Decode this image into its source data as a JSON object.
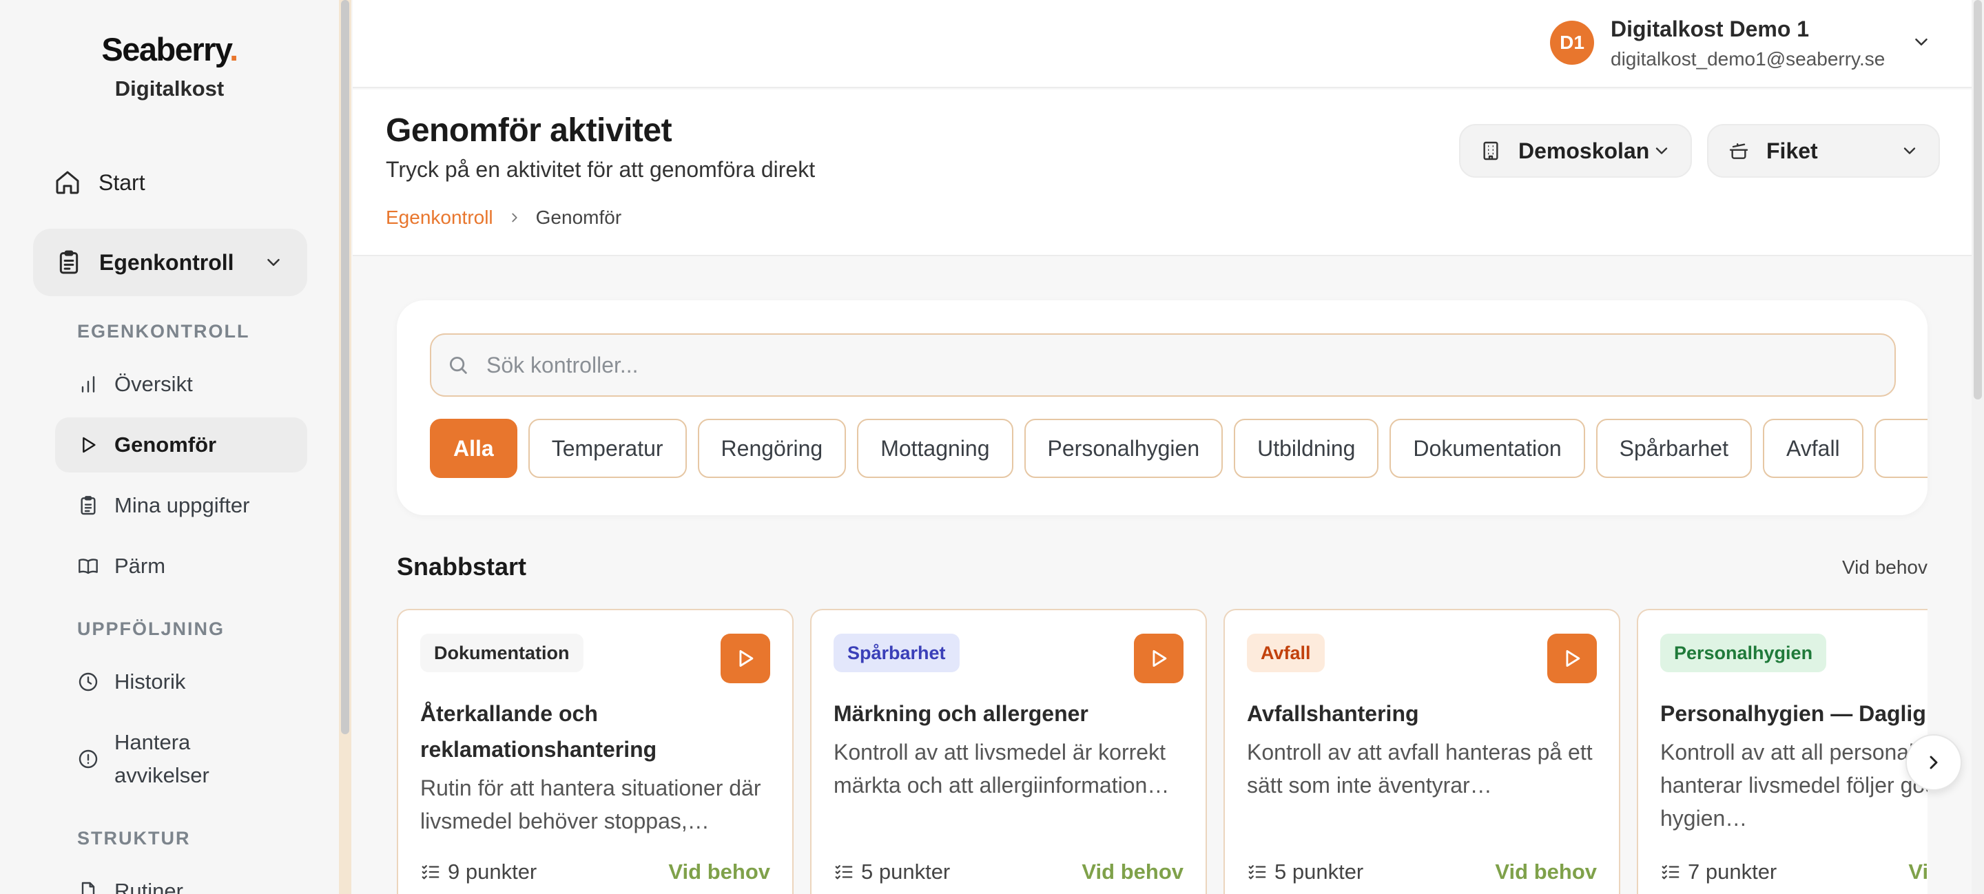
{
  "brand": {
    "name": "Seaberry",
    "dot": ".",
    "subtitle": "Digitalkost"
  },
  "sidebar": {
    "start_label": "Start",
    "group_label": "Egenkontroll",
    "sections": {
      "egenkontroll": "EGENKONTROLL",
      "uppfoljning": "UPPFÖLJNING",
      "struktur": "STRUKTUR"
    },
    "items": {
      "oversikt": "Översikt",
      "genomfor": "Genomför",
      "mina_uppgifter": "Mina uppgifter",
      "parm": "Pärm",
      "historik": "Historik",
      "hantera_avvikelser": "Hantera avvikelser",
      "rutiner": "Rutiner"
    }
  },
  "user": {
    "initials": "D1",
    "name": "Digitalkost Demo 1",
    "email": "digitalkost_demo1@seaberry.se"
  },
  "header": {
    "title": "Genomför aktivitet",
    "subtitle": "Tryck på en aktivitet för att genomföra direkt",
    "breadcrumb": {
      "parent": "Egenkontroll",
      "current": "Genomför"
    },
    "school_select": "Demoskolan",
    "kitchen_select": "Fiket"
  },
  "search": {
    "placeholder": "Sök kontroller...",
    "value": ""
  },
  "filters": [
    "Alla",
    "Temperatur",
    "Rengöring",
    "Mottagning",
    "Personalhygien",
    "Utbildning",
    "Dokumentation",
    "Spårbarhet",
    "Avfall",
    ""
  ],
  "quickstart": {
    "title": "Snabbstart",
    "right_label": "Vid behov",
    "cards": [
      {
        "category": "Dokumentation",
        "title": "Återkallande och reklamationshantering",
        "description": "Rutin för att hantera situationer där livsmedel behöver stoppas,…",
        "points": "9 punkter",
        "frequency": "Vid behov"
      },
      {
        "category": "Spårbarhet",
        "title": "Märkning och allergener",
        "description": "Kontroll av att livsmedel är korrekt märkta och att allergiinformation…",
        "points": "5 punkter",
        "frequency": "Vid behov"
      },
      {
        "category": "Avfall",
        "title": "Avfallshantering",
        "description": "Kontroll av att avfall hanteras på ett sätt som inte äventyrar…",
        "points": "5 punkter",
        "frequency": "Vid behov"
      },
      {
        "category": "Personalhygien",
        "title": "Personalhygien — Daglig kontroll",
        "description": "Kontroll av att all personal som hanterar livsmedel följer god hygien…",
        "points": "7 punkter",
        "frequency": "Vid behov"
      }
    ]
  },
  "colors": {
    "accent": "#e8762d",
    "frequency_green": "#7fa14a",
    "badge_dokumentation_bg": "#f6f6f6",
    "badge_sparbarhet_bg": "#e3e7fb",
    "badge_avfall_bg": "#fdebdc",
    "badge_personalhygien_bg": "#dff4e4"
  }
}
